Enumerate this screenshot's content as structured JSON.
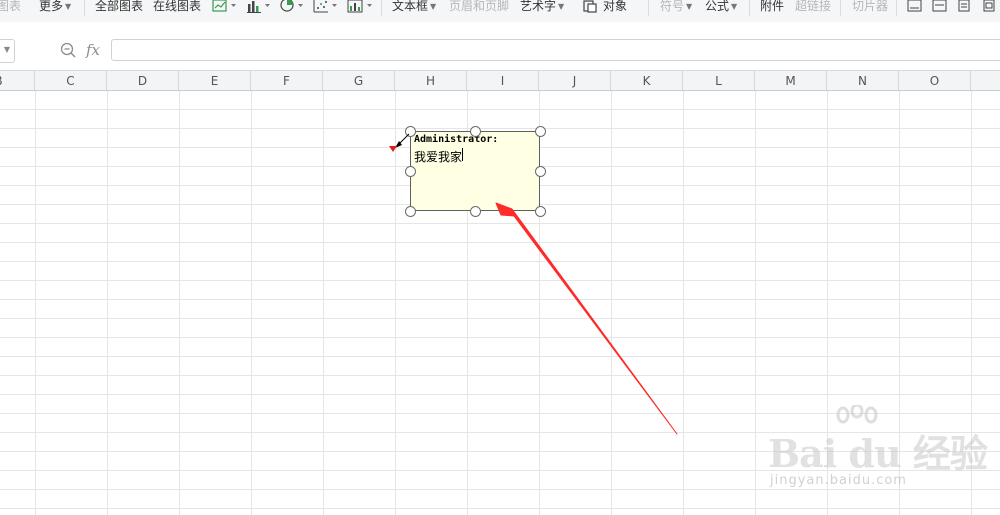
{
  "toolbar": {
    "items": [
      {
        "label": "图表",
        "caret": false,
        "disabled": true
      },
      {
        "label": "更多",
        "caret": true,
        "disabled": false
      },
      {
        "label": "全部图表",
        "caret": false,
        "disabled": false
      },
      {
        "label": "在线图表",
        "caret": false,
        "disabled": false
      },
      {
        "label": "文本框",
        "caret": true,
        "disabled": false
      },
      {
        "label": "页眉和页脚",
        "caret": false,
        "disabled": true
      },
      {
        "label": "艺术字",
        "caret": true,
        "disabled": false
      },
      {
        "label": "对象",
        "caret": false,
        "disabled": false
      },
      {
        "label": "符号",
        "caret": true,
        "disabled": true
      },
      {
        "label": "公式",
        "caret": true,
        "disabled": false
      },
      {
        "label": "附件",
        "caret": false,
        "disabled": false
      },
      {
        "label": "超链接",
        "caret": false,
        "disabled": true
      },
      {
        "label": "切片器",
        "caret": false,
        "disabled": true
      }
    ],
    "icons": [
      "line-chart-icon",
      "bar-chart-icon",
      "pie-chart-icon",
      "scatter-chart-icon",
      "combo-chart-icon",
      "object-icon",
      "header-footer-icon",
      "wordart-icon",
      "print-title-icon",
      "page-icon"
    ],
    "colors": {
      "chart_icon_green": "#3a9a52",
      "disabled_text": "#b4b6b9"
    }
  },
  "formula_bar": {
    "fx_label": "fx",
    "value": "",
    "icons": [
      "zoom-search-icon"
    ]
  },
  "columns": [
    "B",
    "C",
    "D",
    "E",
    "F",
    "G",
    "H",
    "I",
    "J",
    "K",
    "L",
    "M",
    "N",
    "O"
  ],
  "comment": {
    "author": "Administrator:",
    "text": "我爱我家",
    "indicator_color": "#e02020",
    "background": "#ffffe3"
  },
  "annotation": {
    "arrow_color": "#ff2a2a"
  },
  "watermark": {
    "logo": "Bai du 经验",
    "site": "jingyan.baidu.com"
  }
}
